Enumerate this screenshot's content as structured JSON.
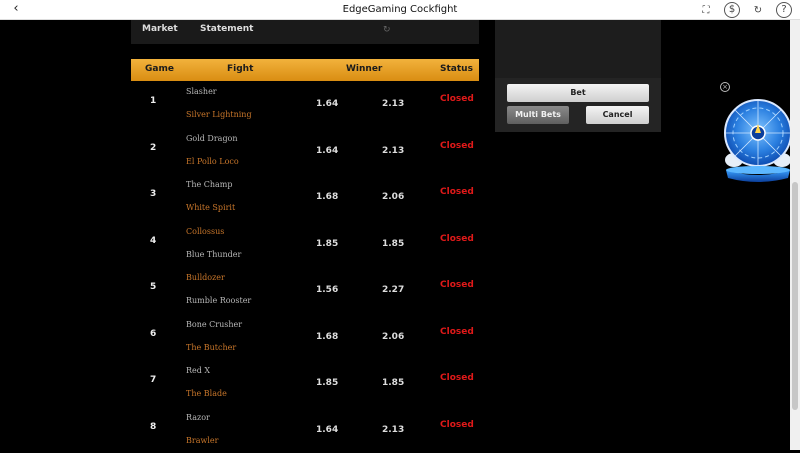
{
  "topbar": {
    "title": "EdgeGaming Cockfight"
  },
  "tabs": {
    "market": "Market",
    "statement": "Statement"
  },
  "table": {
    "headers": {
      "game": "Game",
      "fight": "Fight",
      "winner": "Winner",
      "status": "Status"
    },
    "rows": [
      {
        "game": "1",
        "fighter1": "Slasher",
        "fighter2": "Silver Lightning",
        "odds1": "1.64",
        "odds2": "2.13",
        "status": "Closed"
      },
      {
        "game": "2",
        "fighter1": "Gold Dragon",
        "fighter2": "El Pollo Loco",
        "odds1": "1.64",
        "odds2": "2.13",
        "status": "Closed"
      },
      {
        "game": "3",
        "fighter1": "The Champ",
        "fighter2": "White Spirit",
        "odds1": "1.68",
        "odds2": "2.06",
        "status": "Closed"
      },
      {
        "game": "4",
        "fighter1": "Collossus",
        "fighter2": "Blue Thunder",
        "odds1": "1.85",
        "odds2": "1.85",
        "status": "Closed"
      },
      {
        "game": "5",
        "fighter1": "Bulldozer",
        "fighter2": "Rumble Rooster",
        "odds1": "1.56",
        "odds2": "2.27",
        "status": "Closed"
      },
      {
        "game": "6",
        "fighter1": "Bone Crusher",
        "fighter2": "The Butcher",
        "odds1": "1.68",
        "odds2": "2.06",
        "status": "Closed"
      },
      {
        "game": "7",
        "fighter1": "Red X",
        "fighter2": "The Blade",
        "odds1": "1.85",
        "odds2": "1.85",
        "status": "Closed"
      },
      {
        "game": "8",
        "fighter1": "Razor",
        "fighter2": "Brawler",
        "odds1": "1.64",
        "odds2": "2.13",
        "status": "Closed"
      }
    ]
  },
  "panel": {
    "bet": "Bet",
    "multi_bets": "Multi Bets",
    "cancel": "Cancel"
  },
  "colors": {
    "accent": "#e9a52a",
    "orange_name": "#c8762a",
    "gray_name": "#b8b8b8",
    "status_closed": "#e01919"
  }
}
